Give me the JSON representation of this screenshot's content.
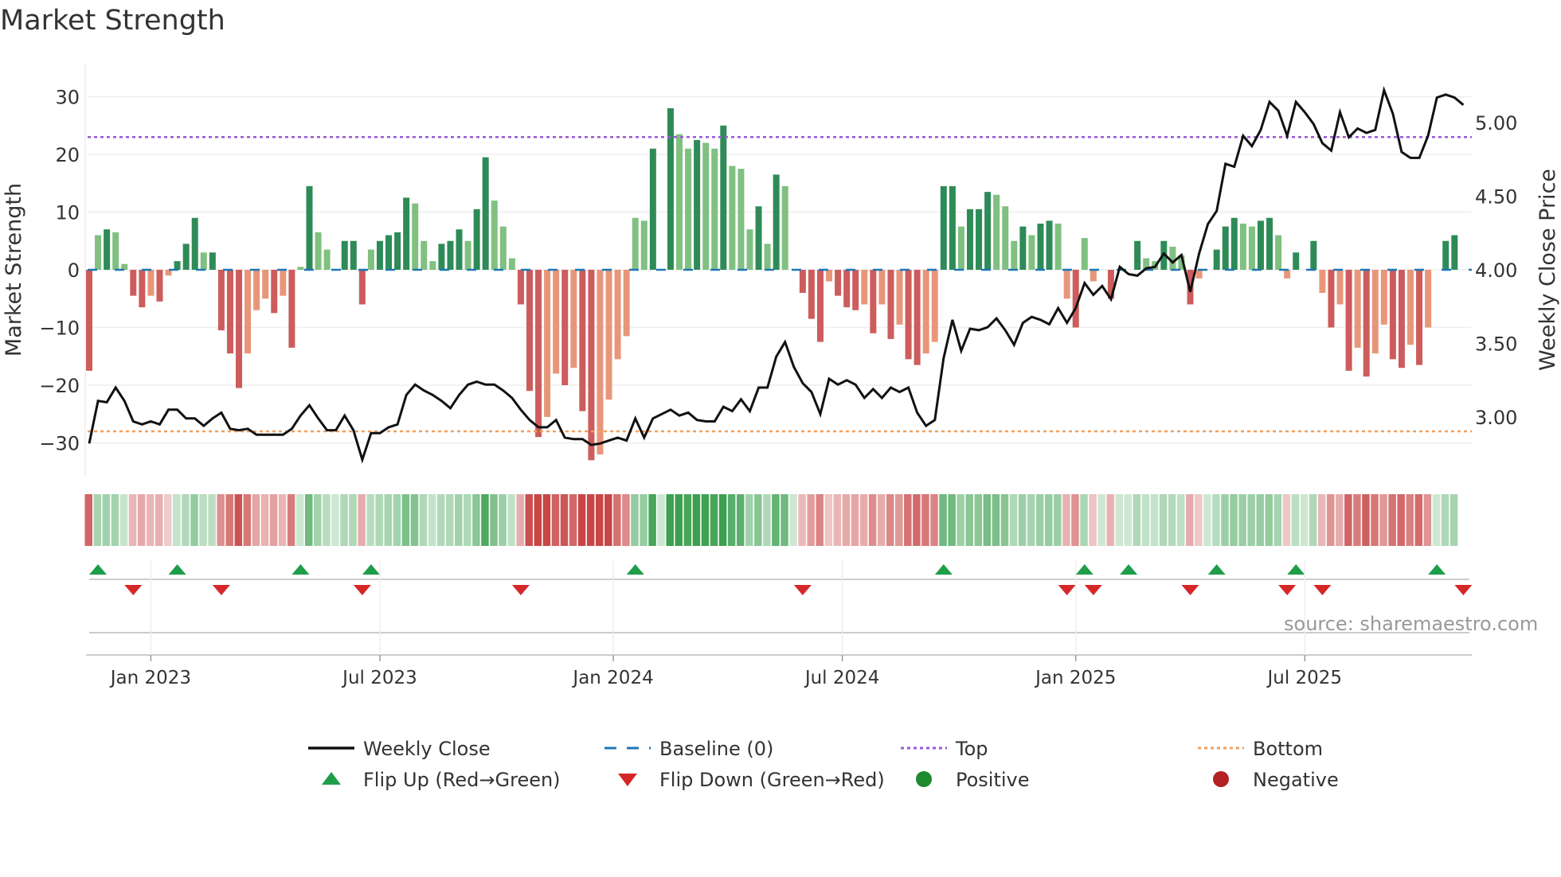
{
  "title": "Market Strength",
  "source": "source: sharemaestro.com",
  "chart_data": {
    "type": "bar+line",
    "title": "Market Strength",
    "ylabel": "Market Strength",
    "y2label": "Weekly Close Price",
    "ylim": [
      -35,
      36
    ],
    "y2lim": [
      2.72,
      5.3
    ],
    "yticks": [
      "30",
      "20",
      "10",
      "0",
      "−10",
      "−20",
      "−30"
    ],
    "ytick_values": [
      30,
      20,
      10,
      0,
      -10,
      -20,
      -30
    ],
    "y2ticks": [
      "5.00",
      "4.50",
      "4.00",
      "3.50",
      "3.00"
    ],
    "y2tick_values": [
      5.0,
      4.5,
      4.0,
      3.5,
      3.0
    ],
    "xticks": [
      "Jan 2023",
      "Jul 2023",
      "Jan 2024",
      "Jul 2024",
      "Jan 2025",
      "Jul 2025"
    ],
    "xtick_week_index": [
      7,
      33,
      59.5,
      85.5,
      112,
      138
    ],
    "frequency": "weekly",
    "top_level": 23,
    "bottom_level": -28,
    "strength": [
      -17.5,
      6,
      7,
      6.5,
      1,
      -4.5,
      -6.5,
      -4.5,
      -5.5,
      -1,
      1.5,
      4.5,
      9,
      3,
      3,
      -10.5,
      -14.5,
      -20.5,
      -14.5,
      -7,
      -5,
      -7.5,
      -4.5,
      -13.5,
      0.5,
      14.5,
      6.5,
      3.5,
      0,
      5,
      5,
      -6,
      3.5,
      5,
      6,
      6.5,
      12.5,
      11.5,
      5,
      1.5,
      4.5,
      5,
      7,
      5,
      10.5,
      19.5,
      12,
      7.5,
      2,
      -6,
      -21,
      -29,
      -25.5,
      -18,
      -20,
      -17,
      -24.5,
      -33,
      -32,
      -22.5,
      -15.5,
      -11.5,
      9,
      8.5,
      21,
      0,
      28,
      23.5,
      21,
      22.5,
      22,
      21,
      25,
      18,
      17.5,
      7,
      11,
      4.5,
      16.5,
      14.5,
      0,
      -4,
      -8.5,
      -12.5,
      -2,
      -4.5,
      -6.5,
      -7,
      -6,
      -11,
      -6,
      -12,
      -9.5,
      -15.5,
      -16.5,
      -14.5,
      -12.5,
      14.5,
      14.5,
      7.5,
      10.5,
      10.5,
      13.5,
      13,
      11,
      5,
      7.5,
      6,
      8,
      8.5,
      8,
      -5,
      -10,
      5.5,
      -2,
      0,
      -5,
      0,
      0,
      5,
      2,
      1.5,
      5,
      4,
      2.5,
      -6,
      -1.5,
      0,
      3.5,
      7.5,
      9,
      8,
      7.5,
      8.5,
      9,
      6,
      -1.5,
      3,
      0,
      5,
      -4,
      -10,
      -6,
      -17.5,
      -13.5,
      -18.5,
      -14.5,
      -9.5,
      -15.5,
      -17,
      -13,
      -16.5,
      -10,
      0,
      5,
      6
    ],
    "weekly_close": [
      2.82,
      3.11,
      3.1,
      3.2,
      3.11,
      2.97,
      2.95,
      2.97,
      2.95,
      3.05,
      3.05,
      2.99,
      2.99,
      2.94,
      2.99,
      3.03,
      2.92,
      2.91,
      2.92,
      2.88,
      2.88,
      2.88,
      2.88,
      2.92,
      3.01,
      3.08,
      2.99,
      2.91,
      2.91,
      3.01,
      2.91,
      2.71,
      2.89,
      2.89,
      2.93,
      2.95,
      3.15,
      3.22,
      3.18,
      3.15,
      3.11,
      3.06,
      3.15,
      3.22,
      3.24,
      3.22,
      3.22,
      3.18,
      3.13,
      3.05,
      2.98,
      2.93,
      2.93,
      2.98,
      2.86,
      2.85,
      2.85,
      2.81,
      2.82,
      2.84,
      2.86,
      2.84,
      2.99,
      2.86,
      2.99,
      3.02,
      3.05,
      3.01,
      3.03,
      2.98,
      2.97,
      2.97,
      3.07,
      3.04,
      3.12,
      3.04,
      3.2,
      3.2,
      3.41,
      3.51,
      3.34,
      3.23,
      3.17,
      3.02,
      3.26,
      3.22,
      3.25,
      3.22,
      3.13,
      3.19,
      3.13,
      3.2,
      3.17,
      3.2,
      3.03,
      2.94,
      2.98,
      3.4,
      3.66,
      3.45,
      3.6,
      3.59,
      3.61,
      3.67,
      3.59,
      3.49,
      3.64,
      3.68,
      3.66,
      3.63,
      3.74,
      3.64,
      3.74,
      3.91,
      3.83,
      3.89,
      3.8,
      4.02,
      3.97,
      3.96,
      4.01,
      4.02,
      4.11,
      4.05,
      4.1,
      3.85,
      4.11,
      4.31,
      4.4,
      4.72,
      4.7,
      4.91,
      4.84,
      4.95,
      5.14,
      5.08,
      4.91,
      5.14,
      5.07,
      4.99,
      4.86,
      4.81,
      5.07,
      4.9,
      4.96,
      4.93,
      4.95,
      5.22,
      5.06,
      4.8,
      4.76,
      4.76,
      4.91,
      5.17,
      5.19,
      5.17,
      5.12
    ],
    "flip_up_week_index": [
      1,
      10,
      24,
      32,
      62,
      97,
      113,
      118,
      128,
      137,
      153
    ],
    "flip_down_week_index": [
      5,
      15,
      31,
      49,
      81,
      111,
      114,
      125,
      136,
      140,
      156
    ],
    "legend": {
      "placement": "bottom",
      "items": [
        {
          "label": "Weekly Close",
          "symbol": "line",
          "color": "#111111"
        },
        {
          "label": "Baseline (0)",
          "symbol": "dash",
          "color": "#1f77b4"
        },
        {
          "label": "Top",
          "symbol": "dot",
          "color": "#9b59d6"
        },
        {
          "label": "Bottom",
          "symbol": "dot",
          "color": "#f0a060"
        },
        {
          "label": "Flip Up (Red→Green)",
          "symbol": "triangle-up",
          "color": "#1e9e48"
        },
        {
          "label": "Flip Down (Green→Red)",
          "symbol": "triangle-down",
          "color": "#d62728"
        },
        {
          "label": "Positive",
          "symbol": "circle",
          "color": "#1e8a2e"
        },
        {
          "label": "Negative",
          "symbol": "circle",
          "color": "#b22222"
        }
      ]
    }
  }
}
